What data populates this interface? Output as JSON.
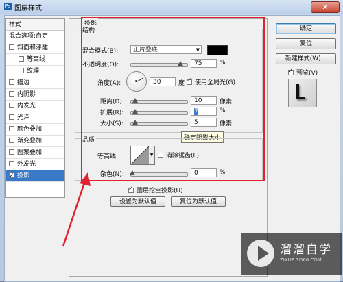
{
  "window": {
    "title": "图层样式",
    "close_symbol": "✕"
  },
  "sidebar": {
    "header": "样式",
    "items": [
      {
        "label": "混合选项:自定",
        "checkbox": false,
        "checked": false,
        "sub": false,
        "selected": false
      },
      {
        "label": "斜面和浮雕",
        "checkbox": true,
        "checked": false,
        "sub": false,
        "selected": false
      },
      {
        "label": "等高线",
        "checkbox": true,
        "checked": false,
        "sub": true,
        "selected": false
      },
      {
        "label": "纹理",
        "checkbox": true,
        "checked": false,
        "sub": true,
        "selected": false
      },
      {
        "label": "描边",
        "checkbox": true,
        "checked": false,
        "sub": false,
        "selected": false
      },
      {
        "label": "内阴影",
        "checkbox": true,
        "checked": false,
        "sub": false,
        "selected": false
      },
      {
        "label": "内发光",
        "checkbox": true,
        "checked": false,
        "sub": false,
        "selected": false
      },
      {
        "label": "光泽",
        "checkbox": true,
        "checked": false,
        "sub": false,
        "selected": false
      },
      {
        "label": "颜色叠加",
        "checkbox": true,
        "checked": false,
        "sub": false,
        "selected": false
      },
      {
        "label": "渐变叠加",
        "checkbox": true,
        "checked": false,
        "sub": false,
        "selected": false
      },
      {
        "label": "图案叠加",
        "checkbox": true,
        "checked": false,
        "sub": false,
        "selected": false
      },
      {
        "label": "外发光",
        "checkbox": true,
        "checked": false,
        "sub": false,
        "selected": false
      },
      {
        "label": "投影",
        "checkbox": true,
        "checked": true,
        "sub": false,
        "selected": true
      }
    ]
  },
  "panel": {
    "section_title": "投影",
    "structure": {
      "title": "结构",
      "blend_mode_label": "混合模式(B):",
      "blend_mode_value": "正片叠底",
      "shadow_color": "#000000",
      "opacity_label": "不透明度(O):",
      "opacity_value": "75",
      "angle_label": "角度(A):",
      "angle_value": "30",
      "angle_unit": "度",
      "global_light_label": "使用全局光(G)",
      "global_light_checked": true,
      "distance_label": "距离(D):",
      "distance_value": "10",
      "size_unit_px": "像素",
      "spread_label": "扩展(R):",
      "spread_value": "7",
      "percent": "%",
      "size_label": "大小(S):",
      "size_value": "5"
    },
    "quality": {
      "title": "品质",
      "contour_label": "等高线:",
      "antialias_label": "消除锯齿(L)",
      "antialias_checked": false,
      "noise_label": "杂色(N):",
      "noise_value": "0"
    },
    "knockout_label": "图层挖空投影(U)",
    "knockout_checked": true,
    "make_default_label": "设置为默认值",
    "reset_default_label": "复位为默认值",
    "tooltip": "确定阴影大小"
  },
  "buttons": {
    "ok": "确定",
    "reset": "复位",
    "new_style": "新建样式(W)...",
    "preview_label": "预览(V)",
    "preview_checked": true
  },
  "watermark": {
    "brand": "溜溜自学",
    "url": "ZIXUE.3D66.COM"
  },
  "colors": {
    "highlight": "#e0212f",
    "selection": "#3a78c8"
  }
}
